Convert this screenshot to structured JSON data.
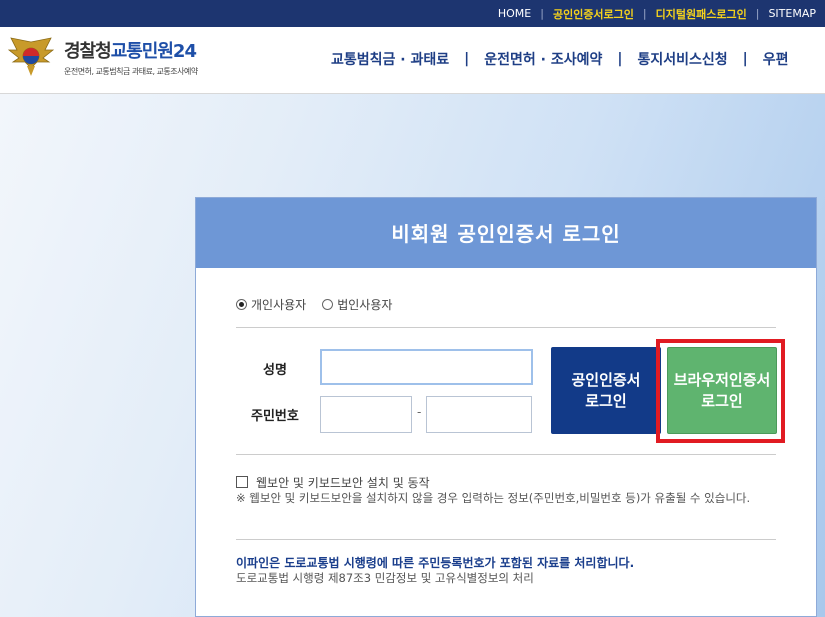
{
  "topbar": {
    "links": [
      {
        "label": "HOME",
        "highlight": false
      },
      {
        "label": "공인인증서로그인",
        "highlight": true
      },
      {
        "label": "디지털원패스로그인",
        "highlight": true
      },
      {
        "label": "SITEMAP",
        "highlight": false
      }
    ],
    "separator": "|"
  },
  "header": {
    "brand_main": "경찰청",
    "brand_accent": "교통민원24",
    "brand_sub": "운전면허, 교통범칙금 과태료, 교통조사예약",
    "logo_icon": "police-emblem-icon",
    "nav": [
      "교통범칙금 · 과태료",
      "운전면허 · 조사예약",
      "통지서비스신청",
      "우편"
    ],
    "nav_separator": "|"
  },
  "panel": {
    "title": "비회원 공인인증서 로그인",
    "radios": [
      {
        "label": "개인사용자",
        "checked": true
      },
      {
        "label": "법인사용자",
        "checked": false
      }
    ],
    "name_label": "성명",
    "id_label": "주민번호",
    "name_value": "",
    "id_front_value": "",
    "id_back_value": "",
    "id_dash": "-",
    "cert_button": [
      "공인인증서",
      "로그인"
    ],
    "browser_button": [
      "브라우저인증서",
      "로그인"
    ],
    "security_checkbox_label": "웹보안 및 키보드보안 설치 및 동작",
    "security_note": "※ 웹보안 및 키보드보안을 설치하지 않을 경우 입력하는 정보(주민번호,비밀번호 등)가 유출될 수 있습니다.",
    "privacy_notice": "이파인은 도로교통법 시행령에 따른 주민등록번호가 포함된 자료를 처리합니다.",
    "privacy_sub": "도로교통법 시행령 제87조3 민감정보 및 고유식별정보의 처리"
  },
  "colors": {
    "topbar_bg": "#1d3570",
    "highlight_link": "#f5d21c",
    "panel_header": "#6e97d6",
    "cert_button": "#123a88",
    "browser_button": "#5fb46f",
    "annotation_box": "#e11b22"
  }
}
